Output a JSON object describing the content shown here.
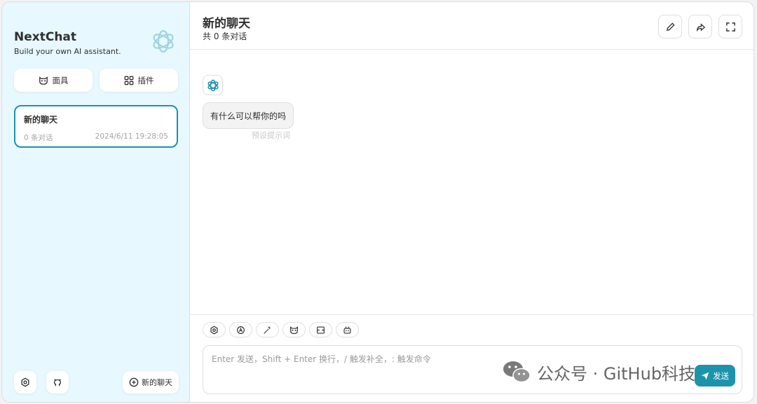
{
  "sidebar": {
    "brand_title": "NextChat",
    "brand_subtitle": "Build your own AI assistant.",
    "mask_label": "面具",
    "plugin_label": "插件",
    "chats": [
      {
        "title": "新的聊天",
        "count": "0 条对话",
        "time": "2024/6/11 19:28:05"
      }
    ],
    "new_chat_label": "新的聊天",
    "accent": "#1d93ab"
  },
  "header": {
    "title": "新的聊天",
    "subtitle": "共 0 条对话"
  },
  "messages": [
    {
      "text": "有什么可以帮你的吗",
      "note": "预设提示词"
    }
  ],
  "input": {
    "placeholder": "Enter 发送，Shift + Enter 换行，/ 触发补全，: 触发命令",
    "send_label": "发送"
  },
  "watermark": {
    "text": "公众号 · GitHub科技"
  }
}
